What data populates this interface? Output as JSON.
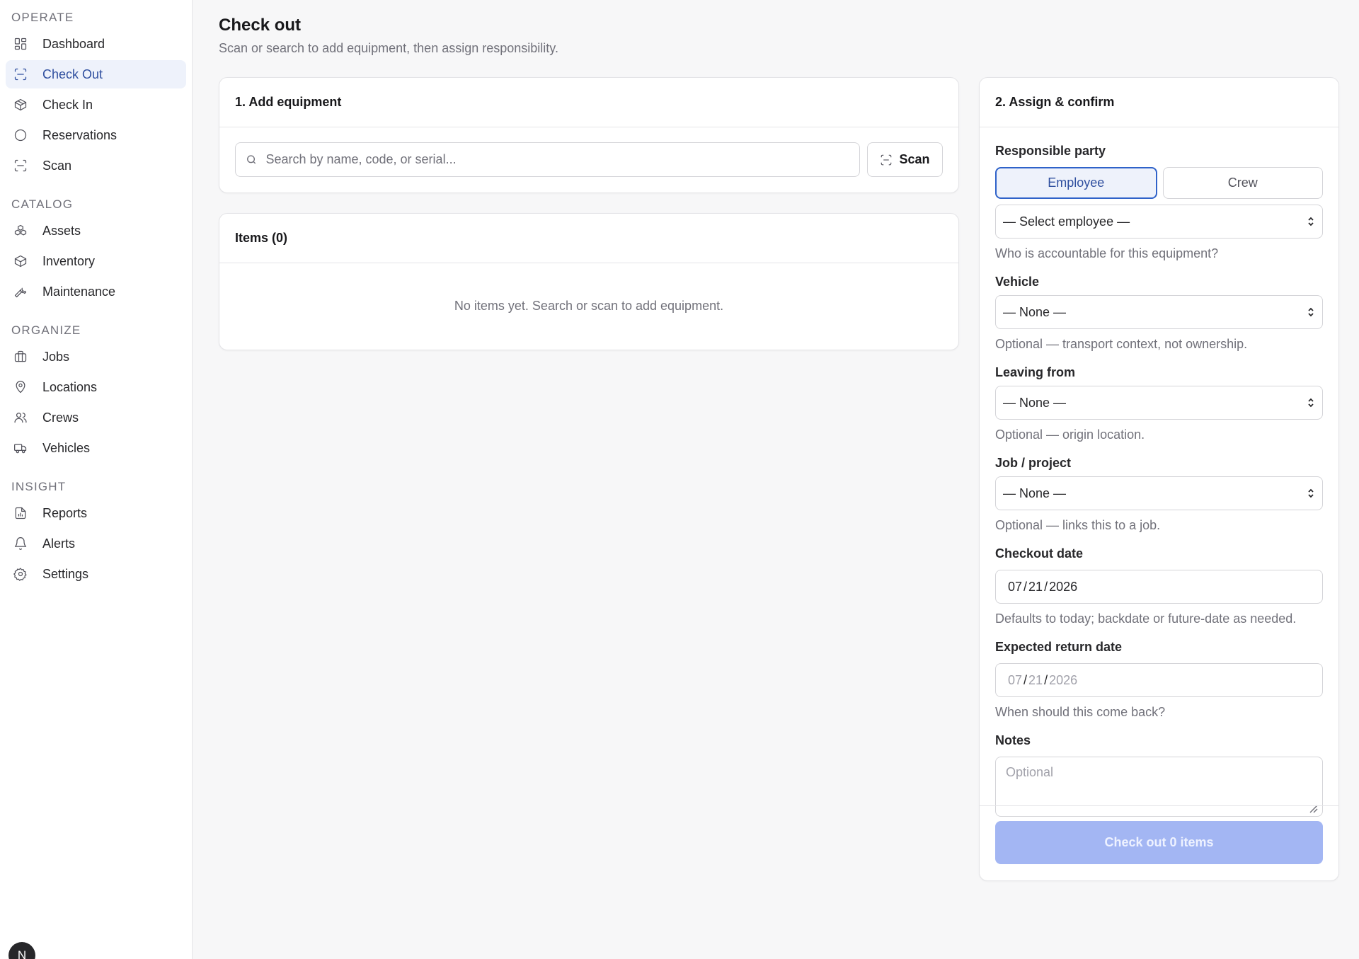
{
  "sidebar": {
    "sections": {
      "operate": "OPERATE",
      "catalog": "CATALOG",
      "organize": "ORGANIZE",
      "insight": "INSIGHT"
    },
    "items": {
      "dashboard": "Dashboard",
      "check_out": "Check Out",
      "check_in": "Check In",
      "reservations": "Reservations",
      "scan": "Scan",
      "assets": "Assets",
      "inventory": "Inventory",
      "maintenance": "Maintenance",
      "jobs": "Jobs",
      "locations": "Locations",
      "crews": "Crews",
      "vehicles": "Vehicles",
      "reports": "Reports",
      "alerts": "Alerts",
      "settings": "Settings"
    },
    "active_item": "check_out",
    "avatar_initial": "N"
  },
  "page": {
    "title": "Check out",
    "subtitle": "Scan or search to add equipment, then assign responsibility."
  },
  "add_equipment": {
    "title": "1. Add equipment",
    "search_placeholder": "Search by name, code, or serial...",
    "scan_label": "Scan"
  },
  "items": {
    "title": "Items (0)",
    "empty": "No items yet. Search or scan to add equipment."
  },
  "assign": {
    "title": "2. Assign & confirm",
    "responsible_label": "Responsible party",
    "toggle_employee": "Employee",
    "toggle_crew": "Crew",
    "employee_select": "— Select employee —",
    "employee_help": "Who is accountable for this equipment?",
    "vehicle_label": "Vehicle",
    "vehicle_select": "— None —",
    "vehicle_help": "Optional — transport context, not ownership.",
    "leaving_label": "Leaving from",
    "leaving_select": "— None —",
    "leaving_help": "Optional — origin location.",
    "job_label": "Job / project",
    "job_select": "— None —",
    "job_help": "Optional — links this to a job.",
    "checkout_label": "Checkout date",
    "checkout_date": {
      "mm": "07",
      "dd": "21",
      "yyyy": "2026"
    },
    "checkout_help": "Defaults to today; backdate or future-date as needed.",
    "return_label": "Expected return date",
    "return_date": {
      "mm": "07",
      "dd": "21",
      "yyyy": "2026"
    },
    "return_help": "When should this come back?",
    "notes_label": "Notes",
    "notes_placeholder": "Optional",
    "submit_label": "Check out 0 items"
  },
  "colors": {
    "accent": "#2f62c9",
    "active_bg": "#eef2fb",
    "disabled_button": "#a3b6f3"
  }
}
